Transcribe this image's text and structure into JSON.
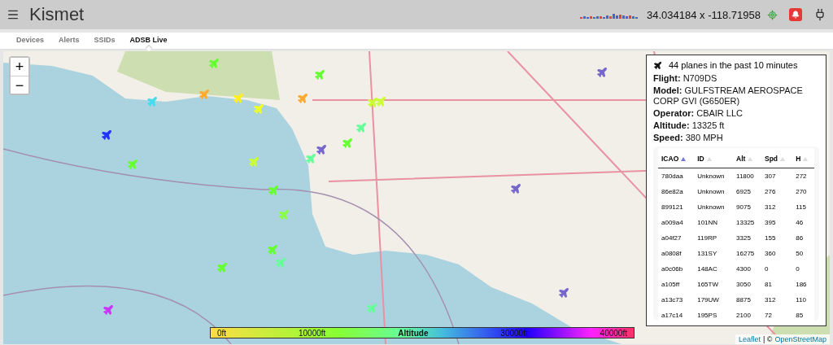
{
  "header": {
    "title": "Kismet",
    "location": "34.034184 x -118.71958"
  },
  "tabs": [
    {
      "label": "Devices",
      "selected": false
    },
    {
      "label": "Alerts",
      "selected": false
    },
    {
      "label": "SSIDs",
      "selected": false
    },
    {
      "label": "ADSB Live",
      "selected": true
    }
  ],
  "map": {
    "zoom_in": "+",
    "zoom_out": "−",
    "planes": [
      {
        "color": "#66ff33"
      },
      {
        "color": "#44ddee"
      },
      {
        "color": "#ffaa33"
      },
      {
        "color": "#ffee22"
      },
      {
        "color": "#eeff22"
      },
      {
        "color": "#2233ff"
      },
      {
        "color": "#66ff33"
      },
      {
        "color": "#ccff33"
      },
      {
        "color": "#66ff33"
      },
      {
        "color": "#88ff44"
      },
      {
        "color": "#66ff33"
      },
      {
        "color": "#66ff99"
      },
      {
        "color": "#66ff33"
      },
      {
        "color": "#cc33ff"
      },
      {
        "color": "#66ff33"
      },
      {
        "color": "#ffaa33"
      },
      {
        "color": "#66ff99"
      },
      {
        "color": "#7766cc"
      },
      {
        "color": "#ccff33"
      },
      {
        "color": "#ccff33"
      },
      {
        "color": "#66ff99"
      },
      {
        "color": "#66ff33"
      },
      {
        "color": "#66ff99"
      },
      {
        "color": "#7766cc"
      },
      {
        "color": "#7766cc"
      },
      {
        "color": "#7766cc"
      }
    ],
    "legend": {
      "title": "Altitude",
      "stops": [
        "0ft",
        "10000ft",
        "30000ft",
        "40000ft"
      ]
    },
    "attribution": {
      "link": "Leaflet",
      "separator": "| ©",
      "source": "OpenStreetMap"
    }
  },
  "panel": {
    "summary": "44 planes in the past 10 minutes",
    "details": [
      {
        "label": "Flight:",
        "value": "N709DS"
      },
      {
        "label": "Model:",
        "value": "GULFSTREAM AEROSPACE CORP GVI (G650ER)"
      },
      {
        "label": "Operator:",
        "value": "CBAIR LLC"
      },
      {
        "label": "Altitude:",
        "value": "13325 ft"
      },
      {
        "label": "Speed:",
        "value": "380 MPH"
      }
    ],
    "table": {
      "columns": [
        {
          "label": "ICAO",
          "sorted": true
        },
        {
          "label": "ID",
          "sorted": false
        },
        {
          "label": "Alt",
          "sorted": false
        },
        {
          "label": "Spd",
          "sorted": false
        },
        {
          "label": "H",
          "sorted": false
        }
      ],
      "rows": [
        [
          "780daa",
          "Unknown",
          "11800",
          "307",
          "272"
        ],
        [
          "86e82a",
          "Unknown",
          "6925",
          "276",
          "270"
        ],
        [
          "899121",
          "Unknown",
          "9075",
          "312",
          "115"
        ],
        [
          "a009a4",
          "101NN",
          "13325",
          "395",
          "46"
        ],
        [
          "a04f27",
          "119RP",
          "3325",
          "155",
          "86"
        ],
        [
          "a0808f",
          "131SY",
          "16275",
          "360",
          "50"
        ],
        [
          "a0c06b",
          "148AC",
          "4300",
          "0",
          "0"
        ],
        [
          "a105ff",
          "165TW",
          "3050",
          "81",
          "186"
        ],
        [
          "a13c73",
          "179UW",
          "8875",
          "312",
          "110"
        ],
        [
          "a17c14",
          "195PS",
          "2100",
          "72",
          "85"
        ]
      ]
    }
  }
}
